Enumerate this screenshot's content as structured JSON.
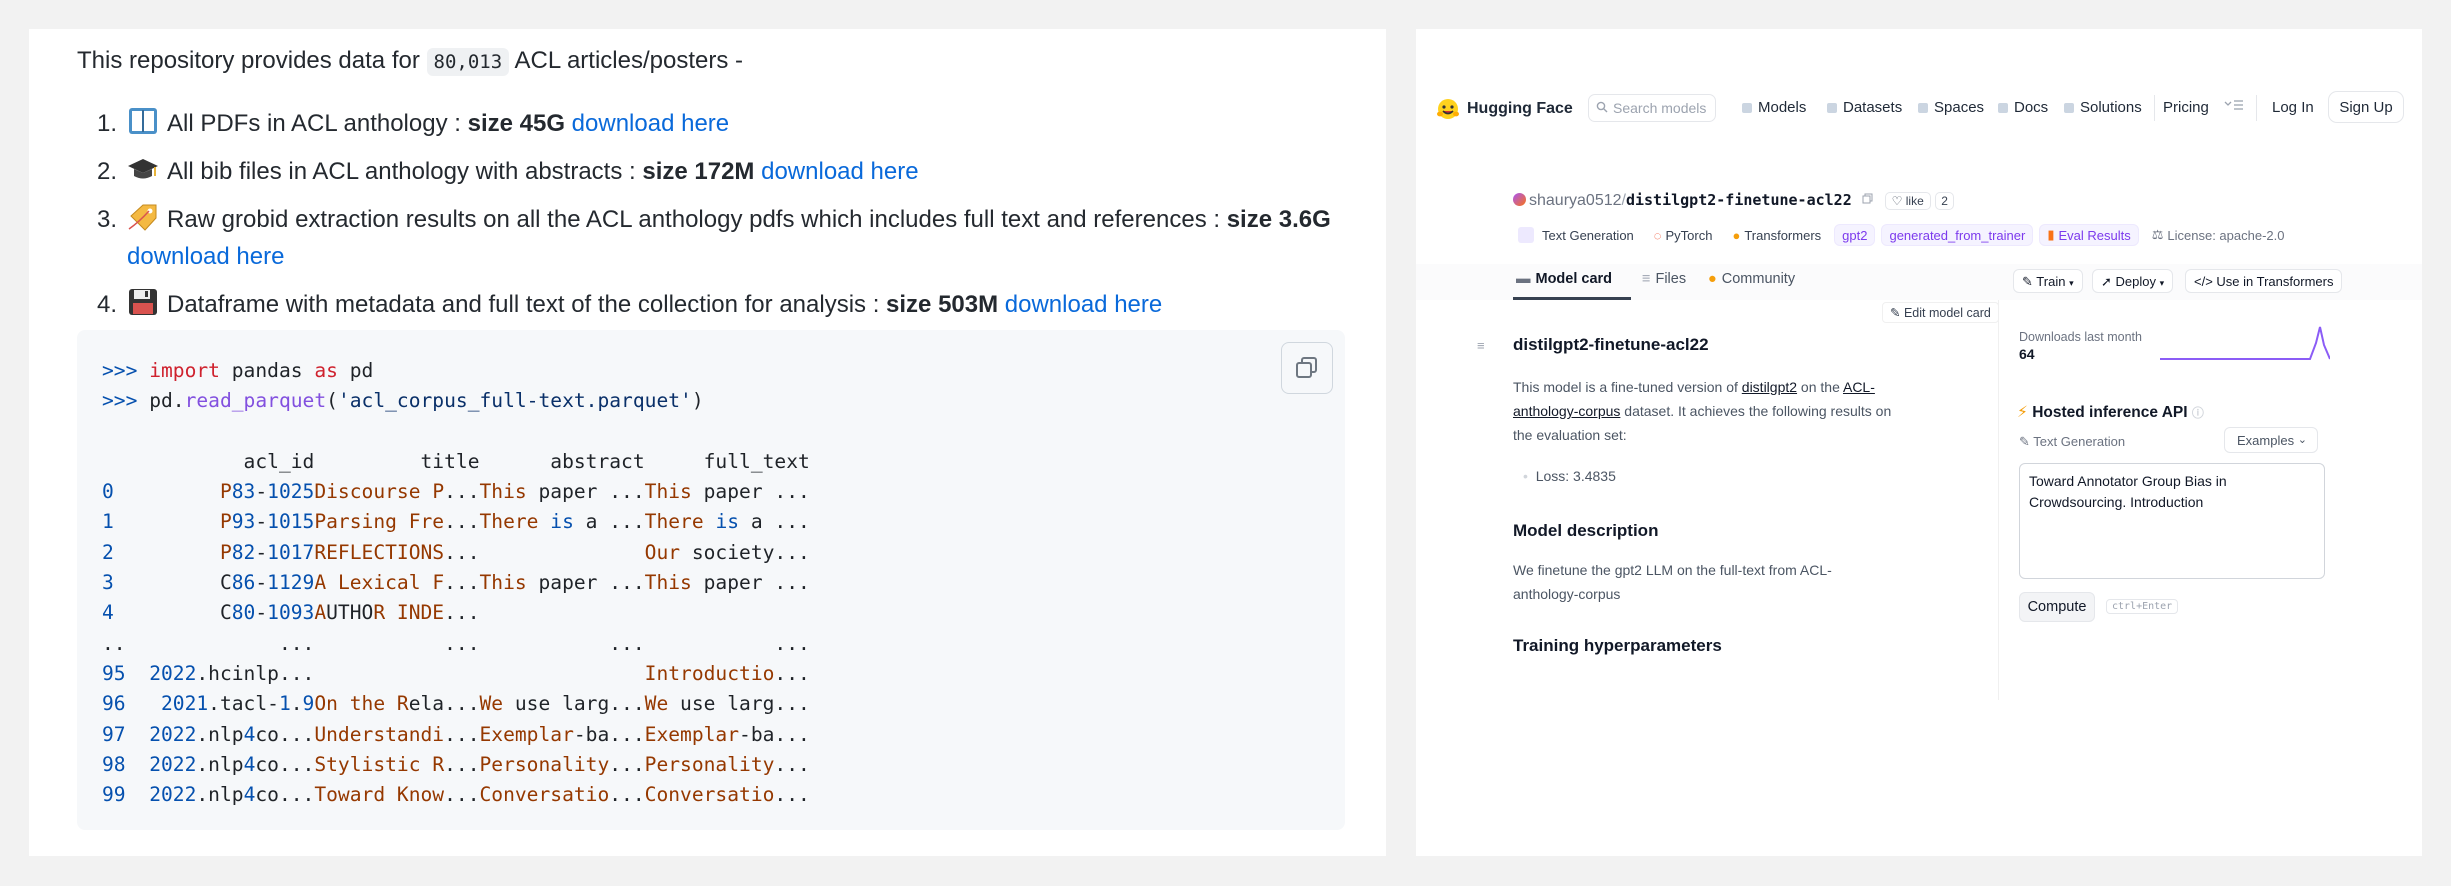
{
  "readme": {
    "intro_before": "This repository provides data for",
    "intro_code": "80,013",
    "intro_after": "ACL articles/posters -",
    "items": [
      {
        "num": "1.",
        "emoji": "book-icon",
        "text": "All PDFs in ACL anthology : ",
        "bold": "size 45G",
        "bold_after": "",
        "link": "download here"
      },
      {
        "num": "2.",
        "emoji": "graduation-cap-icon",
        "text": "All bib files in ACL anthology with abstracts : ",
        "bold": "size 172M",
        "bold_after": "",
        "link": "download here"
      },
      {
        "num": "3.",
        "emoji": "label-icon",
        "text": "Raw grobid extraction results on all the ACL anthology pdfs which includes full text and references : ",
        "bold": "size 3.6G",
        "bold_after": "",
        "link": "download here"
      },
      {
        "num": "4.",
        "emoji": "floppy-disk-icon",
        "text": "Dataframe with metadata and full text of the collection for analysis : ",
        "bold": "size 503M",
        "bold_after": "",
        "link": "download here"
      }
    ]
  },
  "code": {
    "line1": {
      "prompt": ">>>",
      "kw1": "import",
      "mod": "pandas",
      "kw2": "as",
      "alias": "pd"
    },
    "line2": {
      "prompt": ">>>",
      "obj": "pd.",
      "fn": "read_parquet",
      "arg": "'acl_corpus_full-text.parquet'"
    },
    "header": {
      "c0": "acl_id",
      "c1": "title",
      "c2": "abstract",
      "c3": "full_text"
    },
    "rows": [
      {
        "idx": "0",
        "acl_id": "P83-1025",
        "title": "Discourse P...",
        "abstract": "This paper ...",
        "full_text": "This paper ..."
      },
      {
        "idx": "1",
        "acl_id": "P93-1015",
        "title": "Parsing Fre...",
        "abstract": "There is a ...",
        "full_text": "There is a ..."
      },
      {
        "idx": "2",
        "acl_id": "P82-1017",
        "title": "REFLECTIONS...",
        "abstract": "",
        "full_text": "Our society..."
      },
      {
        "idx": "3",
        "acl_id": "C86-1129",
        "title": "A Lexical F...",
        "abstract": "This paper ...",
        "full_text": "This paper ..."
      },
      {
        "idx": "4",
        "acl_id": "C80-1093",
        "title": "AUTHOR INDE...",
        "abstract": "",
        "full_text": ""
      },
      {
        "idx": "..",
        "acl_id": "...",
        "title": "...",
        "abstract": "...",
        "full_text": "..."
      },
      {
        "idx": "95",
        "acl_id": "2022.hcinlp...",
        "title": "",
        "abstract": "",
        "full_text": "Introductio..."
      },
      {
        "idx": "96",
        "acl_id": "2021.tacl-1.9",
        "title": "On the Rela...",
        "abstract": "We use larg...",
        "full_text": "We use larg..."
      },
      {
        "idx": "97",
        "acl_id": "2022.nlp4co...",
        "title": "Understandi...",
        "abstract": "Exemplar-ba...",
        "full_text": "Exemplar-ba..."
      },
      {
        "idx": "98",
        "acl_id": "2022.nlp4co...",
        "title": "Stylistic R...",
        "abstract": "Personality...",
        "full_text": "Personality..."
      },
      {
        "idx": "99",
        "acl_id": "2022.nlp4co...",
        "title": "Toward Know...",
        "abstract": "Conversatio...",
        "full_text": "Conversatio..."
      }
    ]
  },
  "hf": {
    "brand": "Hugging Face",
    "search_placeholder": "Search models",
    "nav": [
      "Models",
      "Datasets",
      "Spaces",
      "Docs",
      "Solutions",
      "Pricing"
    ],
    "login": "Log In",
    "signup": "Sign Up",
    "owner": "shaurya0512",
    "model": "distilgpt2-finetune-acl22",
    "like_label": "like",
    "like_count": "2",
    "tags": [
      "Text Generation",
      "PyTorch",
      "Transformers",
      "gpt2",
      "generated_from_trainer",
      "Eval Results"
    ],
    "license": "License: apache-2.0",
    "tabs": [
      "Model card",
      "Files",
      "Community"
    ],
    "buttons": [
      "Train",
      "Deploy",
      "Use in Transformers"
    ],
    "edit_card": "Edit model card",
    "title": "distilgpt2-finetune-acl22",
    "para1_a": "This model is a fine-tuned version of ",
    "para1_link1": "distilgpt2",
    "para1_b": " on the ",
    "para1_link2": "ACL-anthology-corpus",
    "para1_c": " dataset. It achieves the following results on the evaluation set:",
    "loss": "Loss: 3.4835",
    "h_desc": "Model description",
    "desc": "We finetune the gpt2 LLM on the full-text from ACL-anthology-corpus",
    "h_train": "Training hyperparameters",
    "downloads_label": "Downloads last month",
    "downloads": "64",
    "inference_title": "Hosted inference API",
    "task": "Text Generation",
    "examples": "Examples",
    "input_text": "Toward Annotator Group Bias in Crowdsourcing. Introduction",
    "compute": "Compute",
    "shortcut": "ctrl+Enter",
    "accent": "#7c3aed"
  }
}
